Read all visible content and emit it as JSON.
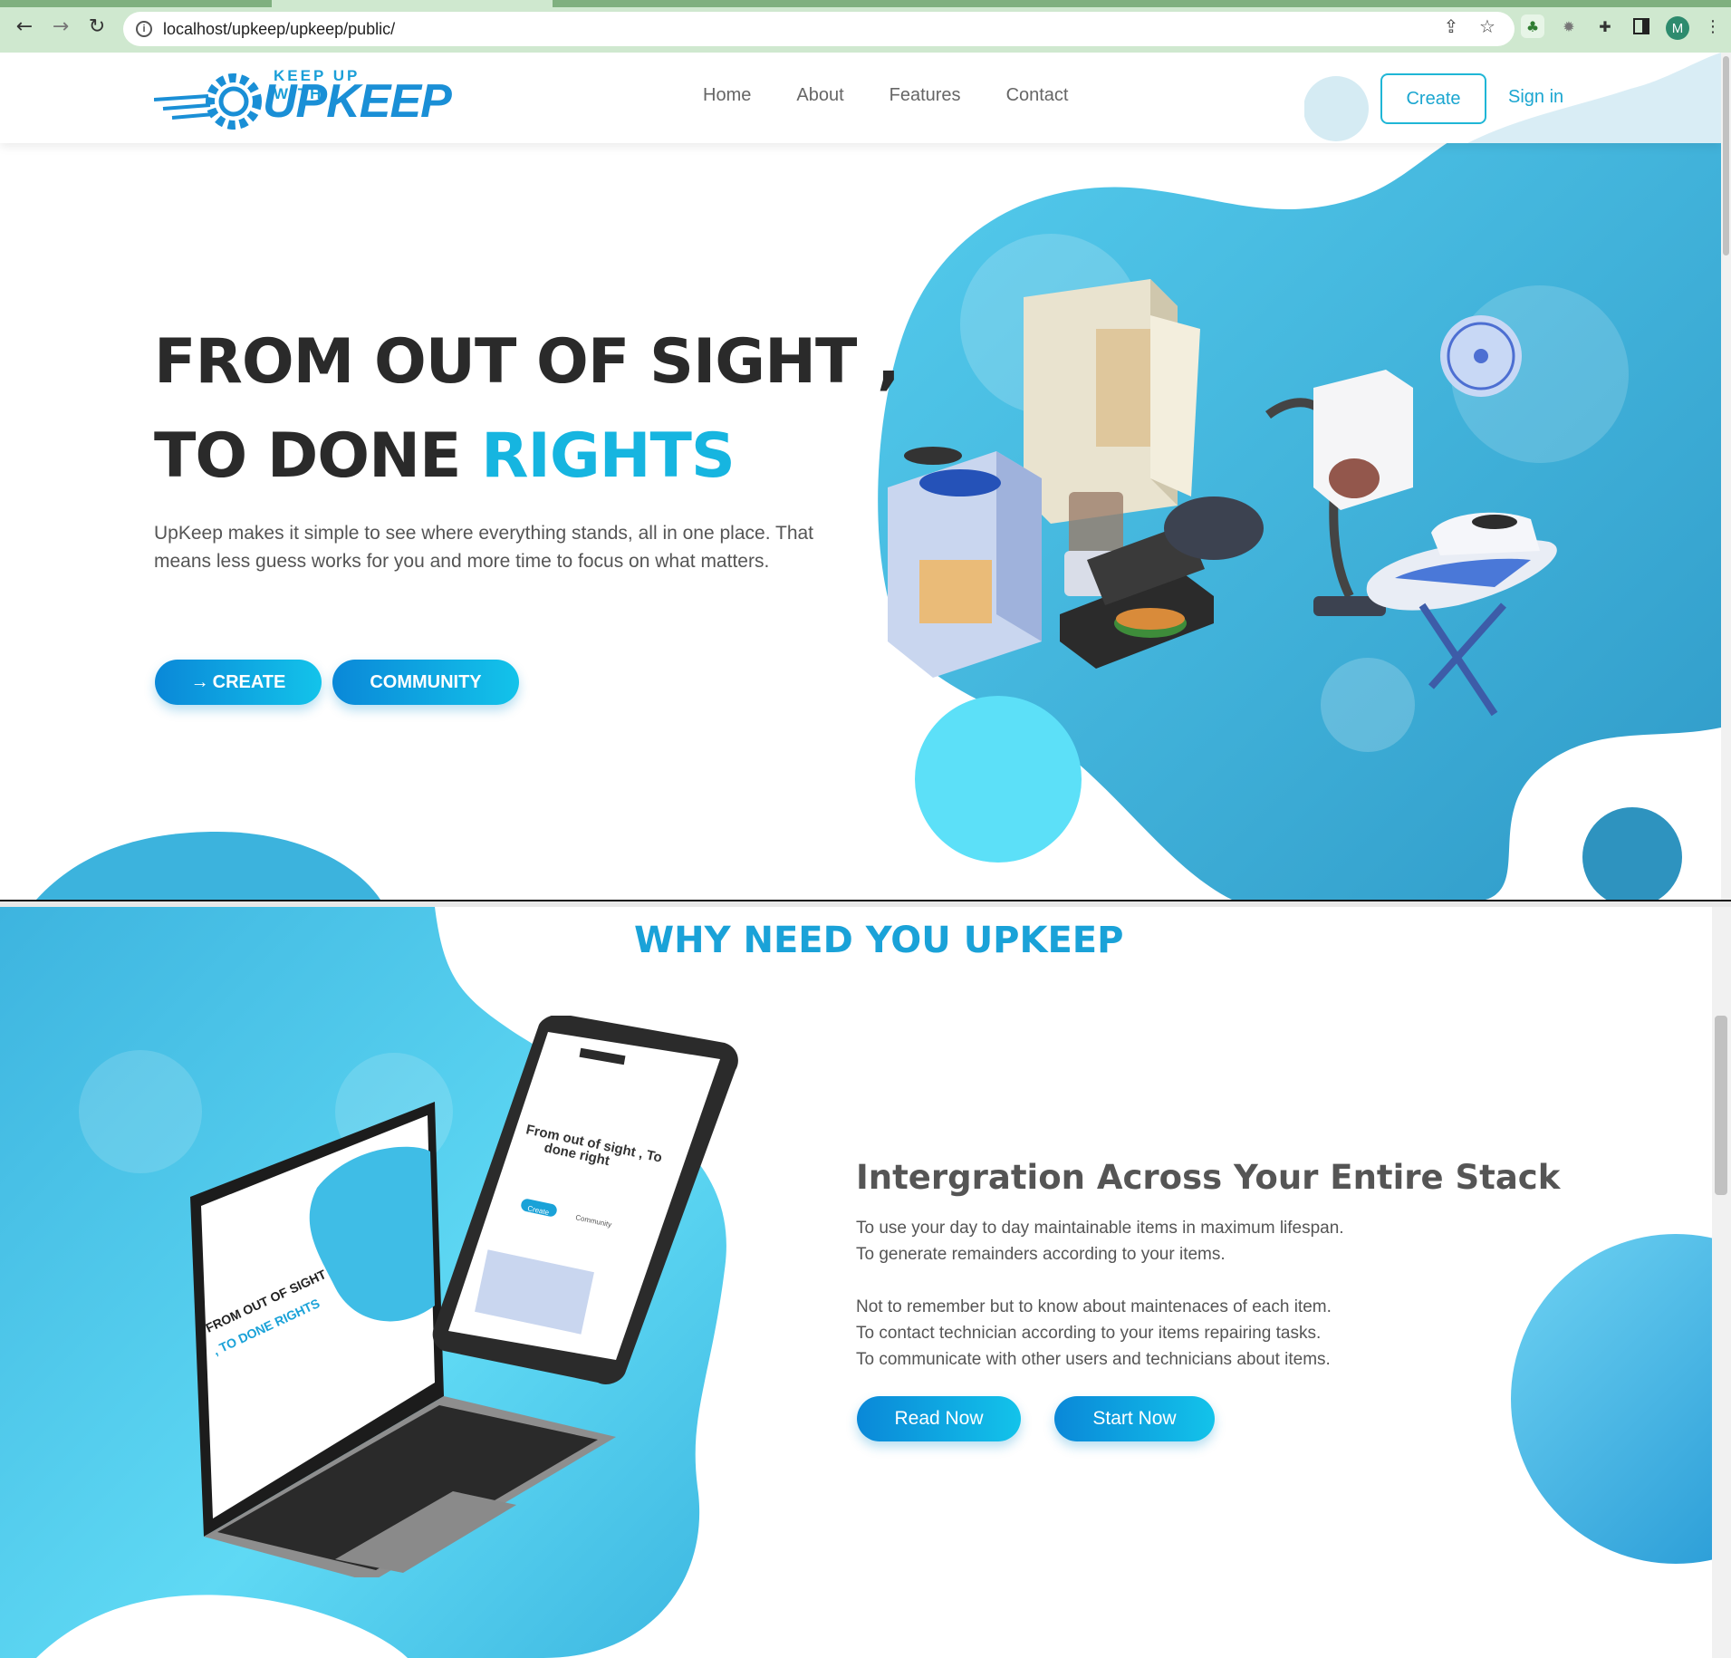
{
  "browser": {
    "url": "localhost/upkeep/upkeep/public/",
    "profile_initial": "M"
  },
  "brand": {
    "logo_top": "KEEP UP WITH",
    "logo_main": "UPKEEP"
  },
  "nav": {
    "links": [
      "Home",
      "About",
      "Features",
      "Contact"
    ],
    "create": "Create",
    "sign_in": "Sign in"
  },
  "hero": {
    "title_line1": "FROM OUT OF SIGHT ,",
    "title_line2_prefix": "TO DONE ",
    "title_line2_accent": "RIGHTS",
    "description": "UpKeep makes it simple to see where everything stands, all in one place. That means less guess works for you and more time to focus on what matters.",
    "create_button": "CREATE",
    "community_button": "COMMUNITY"
  },
  "why": {
    "title": "WHY NEED YOU UPKEEP",
    "heading": "Intergration Across Your Entire Stack",
    "lines_a": [
      "To use your day to day maintainable items in maximum lifespan.",
      "To generate remainders according to your items."
    ],
    "lines_b": [
      "Not to remember but to know about maintenaces of each item.",
      "To contact technician according to your items repairing tasks.",
      "To communicate with other users and technicians about items."
    ],
    "read_button": "Read Now",
    "start_button": "Start Now"
  },
  "mockup": {
    "laptop_headline_1": "FROM OUT OF SIGHT",
    "laptop_headline_2": ", TO DONE RIGHTS",
    "phone_headline_1": "From out of sight , To",
    "phone_headline_2": "done right",
    "phone_btn_1": "Create",
    "phone_btn_2": "Community"
  },
  "colors": {
    "accent": "#16b5e0",
    "accent_dark": "#0a88d8",
    "blob_light": "#5dd8f2",
    "blob_dark": "#2e9fc9"
  }
}
